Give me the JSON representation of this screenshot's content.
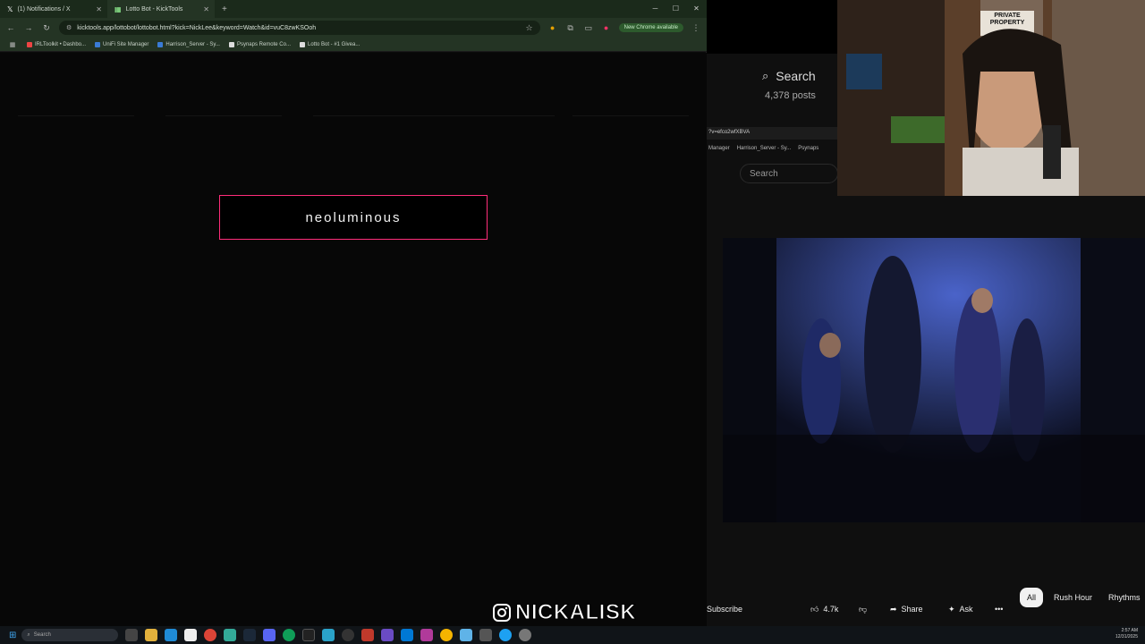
{
  "browser": {
    "tabs": [
      {
        "label": "(1) Notifications / X"
      },
      {
        "label": "Lotto Bot - KickTools"
      }
    ],
    "url": "kicktools.app/lottobot/lottobot.html?kick=NickLee&keyword=Watch&id=vuC8zwKSOoh",
    "new_chrome": "New Chrome available",
    "bookmarks": [
      {
        "label": "IRLToolkit • Dashbo...",
        "color": "#e44"
      },
      {
        "label": "UniFi Site Manager",
        "color": "#3a7bd5"
      },
      {
        "label": "Harrison_Server - Sy...",
        "color": "#3a7bd5"
      },
      {
        "label": "Psynaps Remote Co...",
        "color": "#ddd"
      },
      {
        "label": "Lotto Bot - #1 Givea...",
        "color": "#ddd"
      }
    ]
  },
  "overlay": {
    "text": "neoluminous"
  },
  "youtube": {
    "search_label": "Search",
    "posts": "4,378 posts",
    "url_fragment": "?v=efco2wfXBVA",
    "bookmarks": [
      "Manager",
      "Harrison_Server - Sy...",
      "Psynaps"
    ],
    "search_small": "Search",
    "subscribe": "Subscribe",
    "likes": "4.7k",
    "share": "Share",
    "ask": "Ask",
    "chips": [
      "All",
      "Rush Hour",
      "Rhythms"
    ]
  },
  "webcam": {
    "sign": "PRIVATE PROPERTY"
  },
  "watermark": {
    "handle": "NICKALISK"
  },
  "taskbar": {
    "search": "Search",
    "time": "2:57 AM",
    "date": "12/31/2025"
  },
  "colors": {
    "overlay_border": "#ff2d7a",
    "chrome_green": "#243424"
  }
}
